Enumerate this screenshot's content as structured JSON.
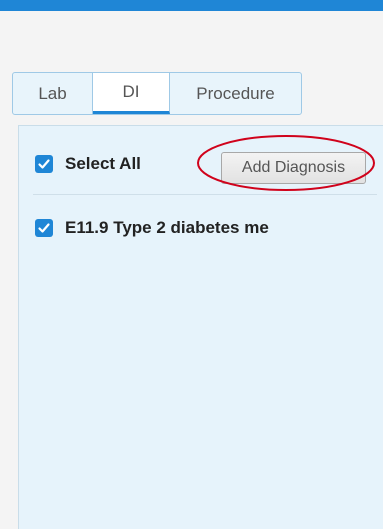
{
  "header": {
    "accent_color": "#1f86d6"
  },
  "tabs": [
    {
      "label": "Lab",
      "active": false
    },
    {
      "label": "DI",
      "active": true
    },
    {
      "label": "Procedure",
      "active": false
    }
  ],
  "panel": {
    "select_all": {
      "label": "Select All",
      "checked": true
    },
    "add_diagnosis_label": "Add Diagnosis",
    "diagnoses": [
      {
        "label": "E11.9 Type 2 diabetes me",
        "checked": true
      }
    ]
  },
  "annotation": {
    "shape": "ellipse",
    "color": "#d0021b",
    "target": "add-diagnosis-button"
  }
}
